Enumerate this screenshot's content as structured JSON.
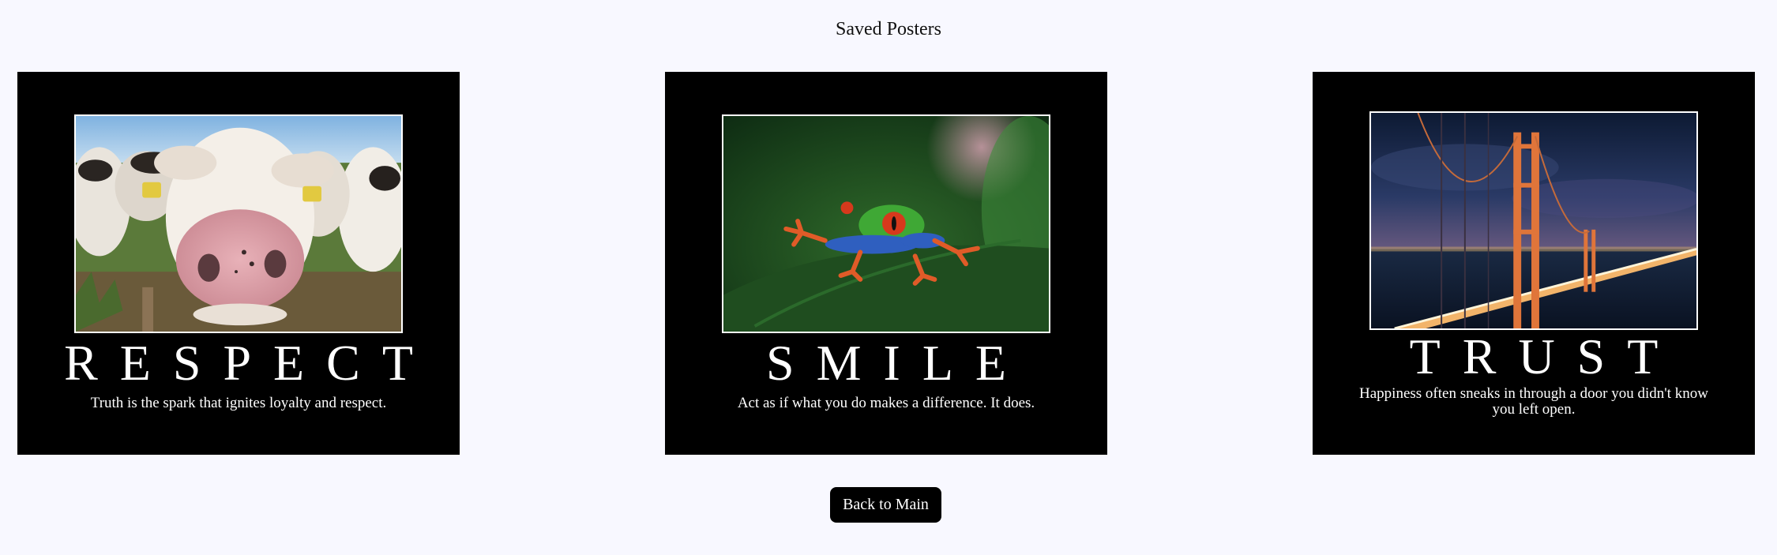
{
  "page": {
    "title": "Saved Posters"
  },
  "posters": [
    {
      "headline": "RESPECT",
      "tagline": "Truth is the spark that ignites loyalty and respect.",
      "image": "cow-closeup-photo"
    },
    {
      "headline": "SMILE",
      "tagline": "Act as if what you do makes a difference. It does.",
      "image": "red-eyed-tree-frog-photo"
    },
    {
      "headline": "TRUST",
      "tagline": "Happiness often sneaks in through a door you didn't know you left open.",
      "image": "golden-gate-bridge-night-photo"
    }
  ],
  "actions": {
    "back_label": "Back to Main"
  },
  "colors": {
    "background": "#f8f8ff",
    "poster": "#000000",
    "text_on_poster": "#ffffff",
    "button": "#000000"
  }
}
